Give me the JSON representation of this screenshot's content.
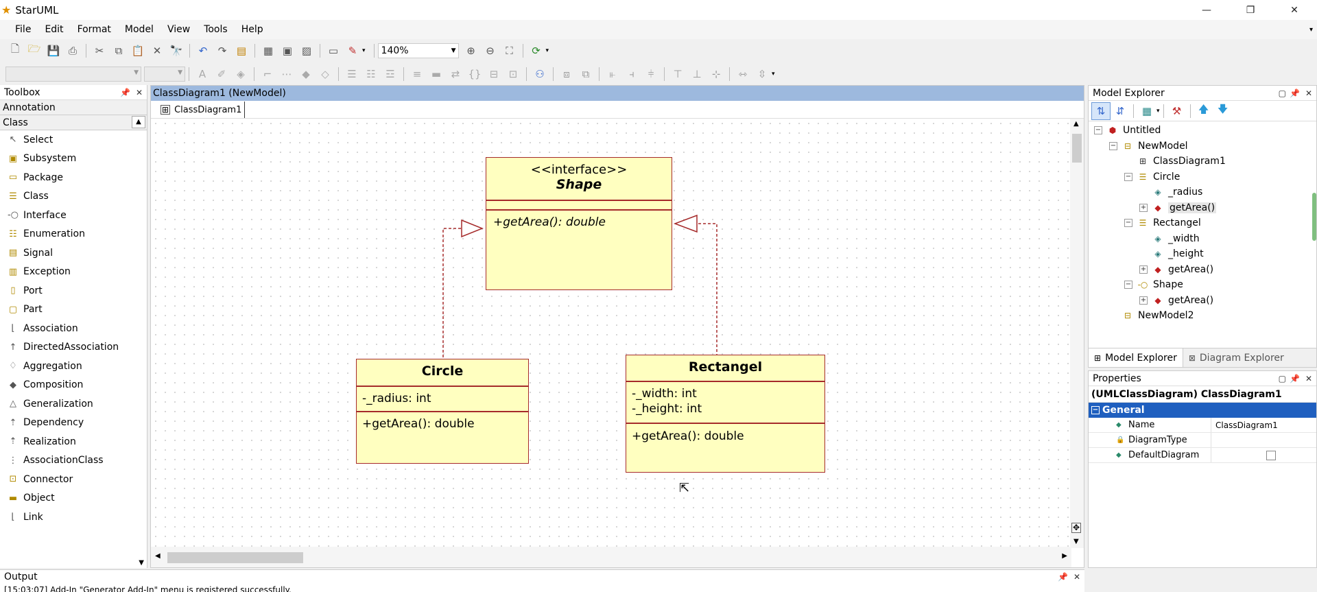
{
  "window": {
    "title": "StarUML"
  },
  "menu": [
    "File",
    "Edit",
    "Format",
    "Model",
    "View",
    "Tools",
    "Help"
  ],
  "toolbar": {
    "zoom": "140%"
  },
  "toolbox": {
    "title": "Toolbox",
    "annotation": "Annotation",
    "category": "Class",
    "items": [
      {
        "label": "Select",
        "icon": "arrow-cursor-icon"
      },
      {
        "label": "Subsystem",
        "icon": "subsystem-icon"
      },
      {
        "label": "Package",
        "icon": "package-icon"
      },
      {
        "label": "Class",
        "icon": "class-icon"
      },
      {
        "label": "Interface",
        "icon": "interface-icon"
      },
      {
        "label": "Enumeration",
        "icon": "enumeration-icon"
      },
      {
        "label": "Signal",
        "icon": "signal-icon"
      },
      {
        "label": "Exception",
        "icon": "exception-icon"
      },
      {
        "label": "Port",
        "icon": "port-icon"
      },
      {
        "label": "Part",
        "icon": "part-icon"
      },
      {
        "label": "Association",
        "icon": "association-icon"
      },
      {
        "label": "DirectedAssociation",
        "icon": "directed-association-icon"
      },
      {
        "label": "Aggregation",
        "icon": "aggregation-icon"
      },
      {
        "label": "Composition",
        "icon": "composition-icon"
      },
      {
        "label": "Generalization",
        "icon": "generalization-icon"
      },
      {
        "label": "Dependency",
        "icon": "dependency-icon"
      },
      {
        "label": "Realization",
        "icon": "realization-icon"
      },
      {
        "label": "AssociationClass",
        "icon": "association-class-icon"
      },
      {
        "label": "Connector",
        "icon": "connector-icon"
      },
      {
        "label": "Object",
        "icon": "object-icon"
      },
      {
        "label": "Link",
        "icon": "link-icon"
      }
    ]
  },
  "diagram": {
    "header": "ClassDiagram1 (NewModel)",
    "tab": "ClassDiagram1",
    "shape": {
      "stereotype": "<<interface>>",
      "name": "Shape",
      "operation": "+getArea(): double"
    },
    "circle": {
      "name": "Circle",
      "attribute": "-_radius: int",
      "operation": "+getArea(): double"
    },
    "rectangel": {
      "name": "Rectangel",
      "attr1": "-_width: int",
      "attr2": "-_height: int",
      "operation": "+getArea(): double"
    }
  },
  "explorer": {
    "title": "Model Explorer",
    "tree": [
      {
        "label": "Untitled",
        "icon": "project-cube-icon",
        "exp": "−"
      },
      {
        "label": "NewModel",
        "icon": "model-folder-icon",
        "exp": "−"
      },
      {
        "label": "ClassDiagram1",
        "icon": "class-diagram-icon",
        "exp": ""
      },
      {
        "label": "Circle",
        "icon": "class-icon",
        "exp": "−"
      },
      {
        "label": "_radius",
        "icon": "attribute-icon",
        "exp": ""
      },
      {
        "label": "getArea()",
        "icon": "operation-icon",
        "exp": "+"
      },
      {
        "label": "Rectangel",
        "icon": "class-icon",
        "exp": "−"
      },
      {
        "label": "_width",
        "icon": "attribute-icon",
        "exp": ""
      },
      {
        "label": "_height",
        "icon": "attribute-icon",
        "exp": ""
      },
      {
        "label": "getArea()",
        "icon": "operation-icon",
        "exp": "+"
      },
      {
        "label": "Shape",
        "icon": "interface-icon",
        "exp": "−"
      },
      {
        "label": "getArea()",
        "icon": "operation-icon",
        "exp": "+"
      },
      {
        "label": "NewModel2",
        "icon": "model-folder-icon",
        "exp": ""
      }
    ],
    "tab_model": "Model Explorer",
    "tab_diagram": "Diagram Explorer"
  },
  "properties": {
    "title": "Properties",
    "selection": "(UMLClassDiagram) ClassDiagram1",
    "section": "General",
    "rows": [
      {
        "key": "Name",
        "value": "ClassDiagram1"
      },
      {
        "key": "DiagramType",
        "value": ""
      },
      {
        "key": "DefaultDiagram",
        "value": ""
      }
    ]
  },
  "output": {
    "title": "Output",
    "line": "[15:03:07]  Add-In \"Generator Add-In\" menu is registered successfully."
  },
  "colors": {
    "accent": "#316ac5",
    "class_fill": "#ffffc0",
    "class_border": "#a52a2a"
  }
}
